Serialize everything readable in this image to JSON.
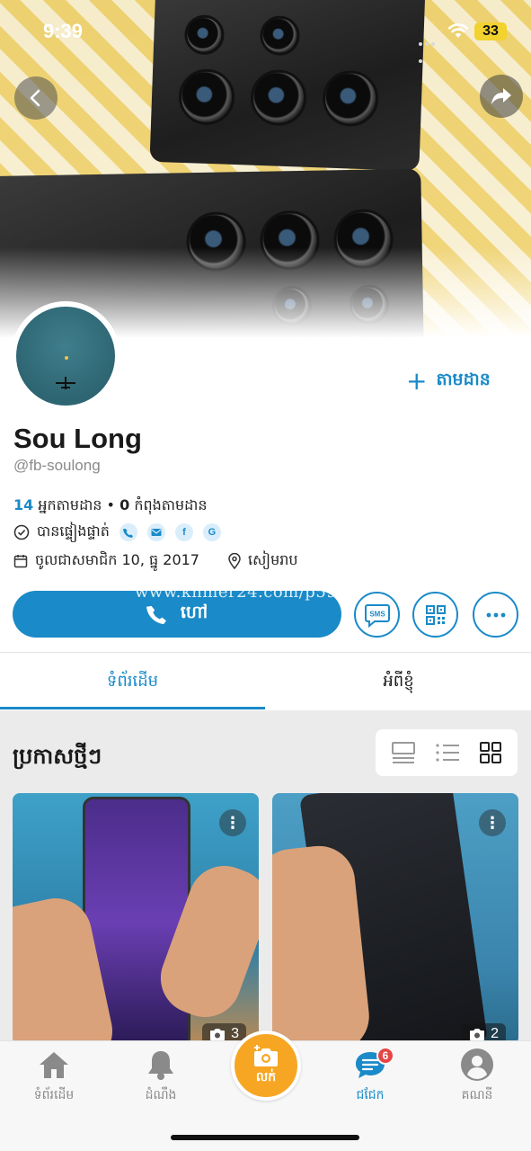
{
  "status_bar": {
    "time": "9:39",
    "battery": "33"
  },
  "profile": {
    "name": "Sou Long",
    "handle": "@fb-soulong",
    "follow_label": "តាមដាន",
    "followers_count": "14",
    "followers_label": "អ្នកតាមដាន",
    "separator": "•",
    "following_count": "0",
    "following_label": "កំពុងតាមដាន",
    "verified_label": "បានផ្ទៀងផ្ទាត់",
    "verify_chips": [
      "phone-icon",
      "email-icon",
      "facebook-icon",
      "google-icon"
    ],
    "joined": "ចូលជាសមាជិក 10, ធ្នូ 2017",
    "location": "សៀមរាប"
  },
  "watermark": "www.khmer24.com/p5990",
  "actions": {
    "call_label": "ហៅ",
    "sms_label": "SMS"
  },
  "tabs": [
    {
      "label": "ទំព័រដើម",
      "active": true
    },
    {
      "label": "អំពីខ្ញុំ",
      "active": false
    }
  ],
  "feed": {
    "title": "ប្រកាសថ្មីៗ",
    "view_modes": [
      "card-view-icon",
      "list-view-icon",
      "grid-view-icon"
    ],
    "active_view": "grid-view-icon",
    "posts": [
      {
        "photo_count": "3"
      },
      {
        "photo_count": "2"
      }
    ]
  },
  "bottom_nav": {
    "home": "ទំព័រដើម",
    "notifications": "ដំណឹង",
    "post": "លក់",
    "messages": "ជជែក",
    "messages_badge": "6",
    "account": "គណនី"
  },
  "colors": {
    "accent": "#1a8ac8",
    "post_button": "#f7a623",
    "badge": "#e64545"
  }
}
